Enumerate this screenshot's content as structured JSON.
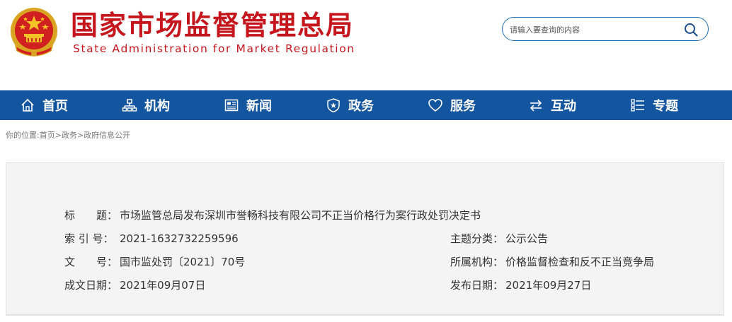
{
  "header": {
    "title_cn": "国家市场监督管理总局",
    "title_en": "State Administration for Market Regulation"
  },
  "search": {
    "placeholder": "请输入要查询的内容"
  },
  "nav": {
    "items": [
      {
        "label": "首页",
        "icon": "home-icon"
      },
      {
        "label": "机构",
        "icon": "org-icon"
      },
      {
        "label": "新闻",
        "icon": "news-icon"
      },
      {
        "label": "政务",
        "icon": "affairs-icon"
      },
      {
        "label": "服务",
        "icon": "heart-icon"
      },
      {
        "label": "互动",
        "icon": "exchange-icon"
      },
      {
        "label": "专题",
        "icon": "topics-icon"
      }
    ]
  },
  "breadcrumb": {
    "prefix": "你的位置:",
    "items": [
      "首页",
      "政务",
      "政府信息公开"
    ],
    "separator": ">"
  },
  "info": {
    "title_label": "标　　题：",
    "title_value": "市场监管总局发布深圳市誉畅科技有限公司不正当价格行为案行政处罚决定书",
    "index_label": "索 引 号：",
    "index_value": "2021-1632732259596",
    "topic_label": "主题分类：",
    "topic_value": "公示公告",
    "docno_label": "文　　号：",
    "docno_value": "国市监处罚〔2021〕70号",
    "org_label": "所属机构：",
    "org_value": "价格监督检查和反不正当竞争局",
    "created_label": "成文日期：",
    "created_value": "2021年09月07日",
    "published_label": "发布日期：",
    "published_value": "2021年09月27日"
  },
  "colors": {
    "brand_red": "#c5161d",
    "nav_blue": "#14559f",
    "search_border": "#1f6fb5"
  }
}
